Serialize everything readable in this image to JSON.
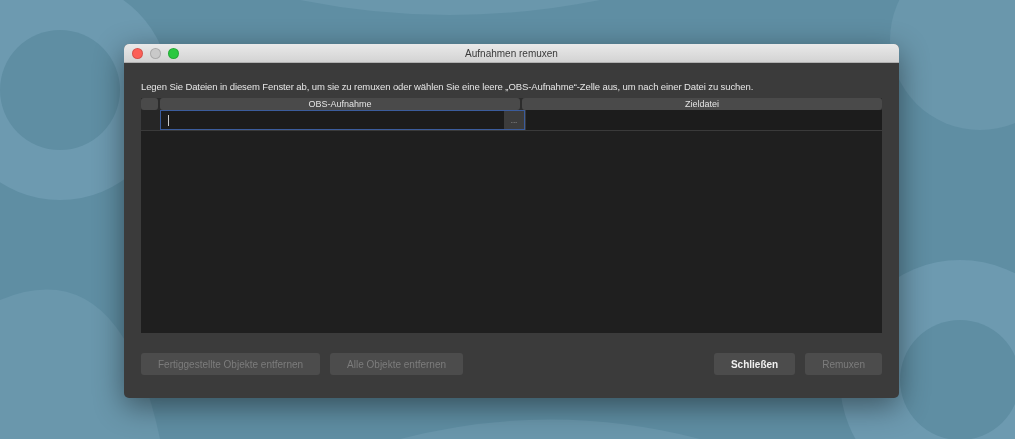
{
  "window": {
    "title": "Aufnahmen remuxen",
    "minimize_enabled": false
  },
  "instruction": "Legen Sie Dateien in diesem Fenster ab, um sie zu remuxen oder wählen Sie eine leere „OBS-Aufnahme“-Zelle aus, um nach einer Datei zu suchen.",
  "table": {
    "columns": [
      "OBS-Aufnahme",
      "Zieldatei"
    ],
    "rows": [
      {
        "focused": true,
        "browse": "..."
      }
    ]
  },
  "left_buttons": [
    {
      "label": "Fertiggestellte Objekte entfernen",
      "disabled": true
    },
    {
      "label": "Alle Objekte entfernen",
      "disabled": true
    }
  ],
  "right_buttons": [
    {
      "label": "Schließen",
      "disabled": false
    },
    {
      "label": "Remuxen",
      "disabled": true
    }
  ]
}
